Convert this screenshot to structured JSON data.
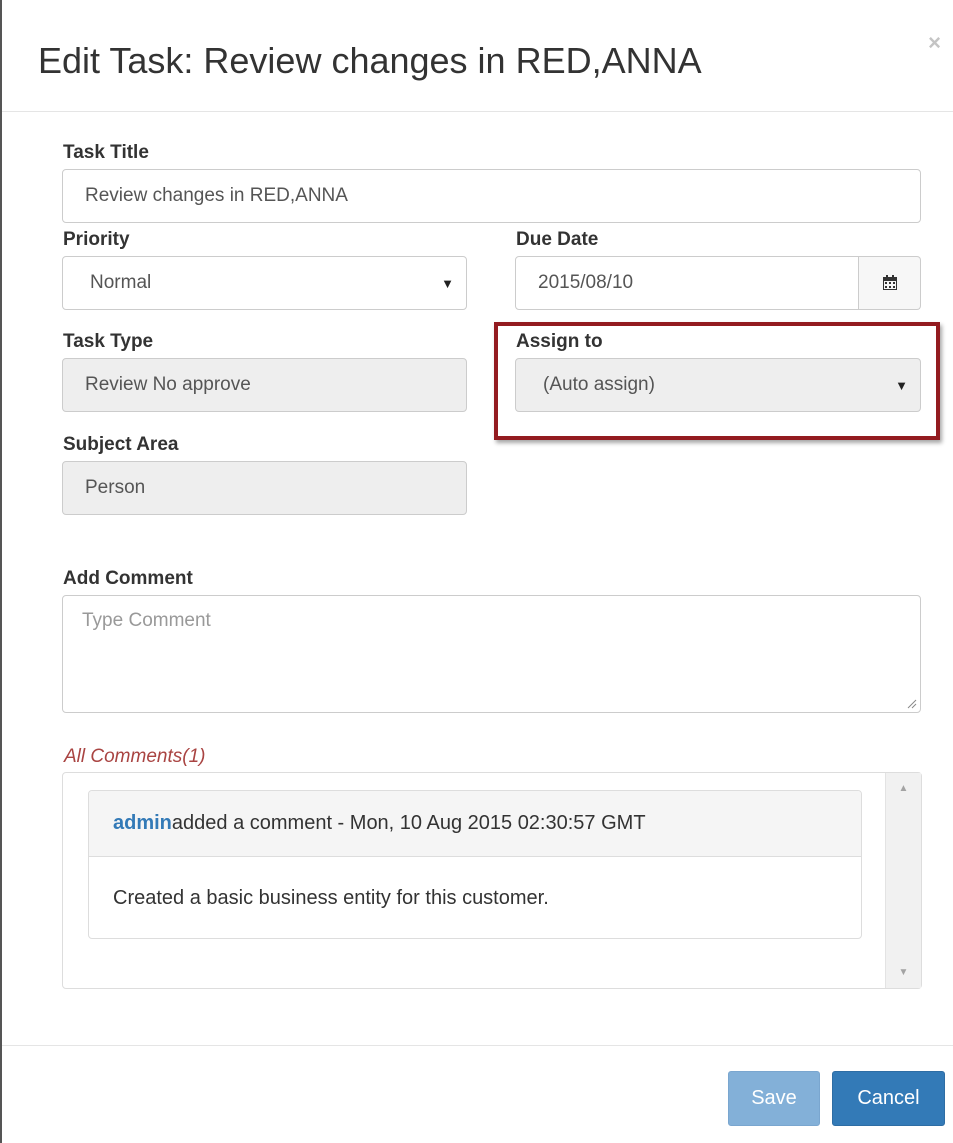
{
  "modal": {
    "title": "Edit Task: Review changes in RED,ANNA",
    "close_label": "×"
  },
  "form": {
    "task_title": {
      "label": "Task Title",
      "value": "Review changes in RED,ANNA"
    },
    "priority": {
      "label": "Priority",
      "value": "Normal"
    },
    "due_date": {
      "label": "Due Date",
      "value": "2015/08/10"
    },
    "task_type": {
      "label": "Task Type",
      "value": "Review No approve"
    },
    "assign_to": {
      "label": "Assign to",
      "value": "(Auto assign)"
    },
    "subject_area": {
      "label": "Subject Area",
      "value": "Person"
    },
    "add_comment": {
      "label": "Add Comment",
      "placeholder": "Type Comment"
    }
  },
  "comments": {
    "header": "All Comments(1)",
    "items": [
      {
        "author": "admin",
        "meta": "added a comment - Mon, 10 Aug 2015 02:30:57 GMT",
        "body": "Created a basic business entity for this customer."
      }
    ]
  },
  "footer": {
    "save_label": "Save",
    "cancel_label": "Cancel"
  },
  "colors": {
    "highlight_border": "#931b20",
    "primary": "#337ab7",
    "comments_header": "#a94442"
  }
}
